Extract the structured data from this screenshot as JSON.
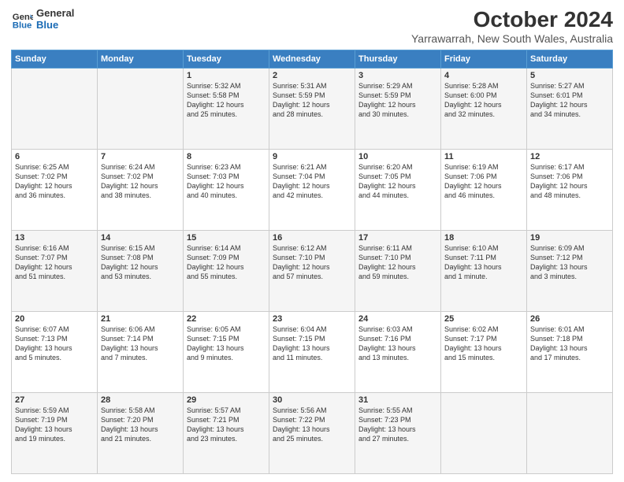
{
  "header": {
    "logo_line1": "General",
    "logo_line2": "Blue",
    "title": "October 2024",
    "subtitle": "Yarrawarrah, New South Wales, Australia"
  },
  "weekdays": [
    "Sunday",
    "Monday",
    "Tuesday",
    "Wednesday",
    "Thursday",
    "Friday",
    "Saturday"
  ],
  "weeks": [
    [
      {
        "day": "",
        "info": ""
      },
      {
        "day": "",
        "info": ""
      },
      {
        "day": "1",
        "info": "Sunrise: 5:32 AM\nSunset: 5:58 PM\nDaylight: 12 hours\nand 25 minutes."
      },
      {
        "day": "2",
        "info": "Sunrise: 5:31 AM\nSunset: 5:59 PM\nDaylight: 12 hours\nand 28 minutes."
      },
      {
        "day": "3",
        "info": "Sunrise: 5:29 AM\nSunset: 5:59 PM\nDaylight: 12 hours\nand 30 minutes."
      },
      {
        "day": "4",
        "info": "Sunrise: 5:28 AM\nSunset: 6:00 PM\nDaylight: 12 hours\nand 32 minutes."
      },
      {
        "day": "5",
        "info": "Sunrise: 5:27 AM\nSunset: 6:01 PM\nDaylight: 12 hours\nand 34 minutes."
      }
    ],
    [
      {
        "day": "6",
        "info": "Sunrise: 6:25 AM\nSunset: 7:02 PM\nDaylight: 12 hours\nand 36 minutes."
      },
      {
        "day": "7",
        "info": "Sunrise: 6:24 AM\nSunset: 7:02 PM\nDaylight: 12 hours\nand 38 minutes."
      },
      {
        "day": "8",
        "info": "Sunrise: 6:23 AM\nSunset: 7:03 PM\nDaylight: 12 hours\nand 40 minutes."
      },
      {
        "day": "9",
        "info": "Sunrise: 6:21 AM\nSunset: 7:04 PM\nDaylight: 12 hours\nand 42 minutes."
      },
      {
        "day": "10",
        "info": "Sunrise: 6:20 AM\nSunset: 7:05 PM\nDaylight: 12 hours\nand 44 minutes."
      },
      {
        "day": "11",
        "info": "Sunrise: 6:19 AM\nSunset: 7:06 PM\nDaylight: 12 hours\nand 46 minutes."
      },
      {
        "day": "12",
        "info": "Sunrise: 6:17 AM\nSunset: 7:06 PM\nDaylight: 12 hours\nand 48 minutes."
      }
    ],
    [
      {
        "day": "13",
        "info": "Sunrise: 6:16 AM\nSunset: 7:07 PM\nDaylight: 12 hours\nand 51 minutes."
      },
      {
        "day": "14",
        "info": "Sunrise: 6:15 AM\nSunset: 7:08 PM\nDaylight: 12 hours\nand 53 minutes."
      },
      {
        "day": "15",
        "info": "Sunrise: 6:14 AM\nSunset: 7:09 PM\nDaylight: 12 hours\nand 55 minutes."
      },
      {
        "day": "16",
        "info": "Sunrise: 6:12 AM\nSunset: 7:10 PM\nDaylight: 12 hours\nand 57 minutes."
      },
      {
        "day": "17",
        "info": "Sunrise: 6:11 AM\nSunset: 7:10 PM\nDaylight: 12 hours\nand 59 minutes."
      },
      {
        "day": "18",
        "info": "Sunrise: 6:10 AM\nSunset: 7:11 PM\nDaylight: 13 hours\nand 1 minute."
      },
      {
        "day": "19",
        "info": "Sunrise: 6:09 AM\nSunset: 7:12 PM\nDaylight: 13 hours\nand 3 minutes."
      }
    ],
    [
      {
        "day": "20",
        "info": "Sunrise: 6:07 AM\nSunset: 7:13 PM\nDaylight: 13 hours\nand 5 minutes."
      },
      {
        "day": "21",
        "info": "Sunrise: 6:06 AM\nSunset: 7:14 PM\nDaylight: 13 hours\nand 7 minutes."
      },
      {
        "day": "22",
        "info": "Sunrise: 6:05 AM\nSunset: 7:15 PM\nDaylight: 13 hours\nand 9 minutes."
      },
      {
        "day": "23",
        "info": "Sunrise: 6:04 AM\nSunset: 7:15 PM\nDaylight: 13 hours\nand 11 minutes."
      },
      {
        "day": "24",
        "info": "Sunrise: 6:03 AM\nSunset: 7:16 PM\nDaylight: 13 hours\nand 13 minutes."
      },
      {
        "day": "25",
        "info": "Sunrise: 6:02 AM\nSunset: 7:17 PM\nDaylight: 13 hours\nand 15 minutes."
      },
      {
        "day": "26",
        "info": "Sunrise: 6:01 AM\nSunset: 7:18 PM\nDaylight: 13 hours\nand 17 minutes."
      }
    ],
    [
      {
        "day": "27",
        "info": "Sunrise: 5:59 AM\nSunset: 7:19 PM\nDaylight: 13 hours\nand 19 minutes."
      },
      {
        "day": "28",
        "info": "Sunrise: 5:58 AM\nSunset: 7:20 PM\nDaylight: 13 hours\nand 21 minutes."
      },
      {
        "day": "29",
        "info": "Sunrise: 5:57 AM\nSunset: 7:21 PM\nDaylight: 13 hours\nand 23 minutes."
      },
      {
        "day": "30",
        "info": "Sunrise: 5:56 AM\nSunset: 7:22 PM\nDaylight: 13 hours\nand 25 minutes."
      },
      {
        "day": "31",
        "info": "Sunrise: 5:55 AM\nSunset: 7:23 PM\nDaylight: 13 hours\nand 27 minutes."
      },
      {
        "day": "",
        "info": ""
      },
      {
        "day": "",
        "info": ""
      }
    ]
  ]
}
